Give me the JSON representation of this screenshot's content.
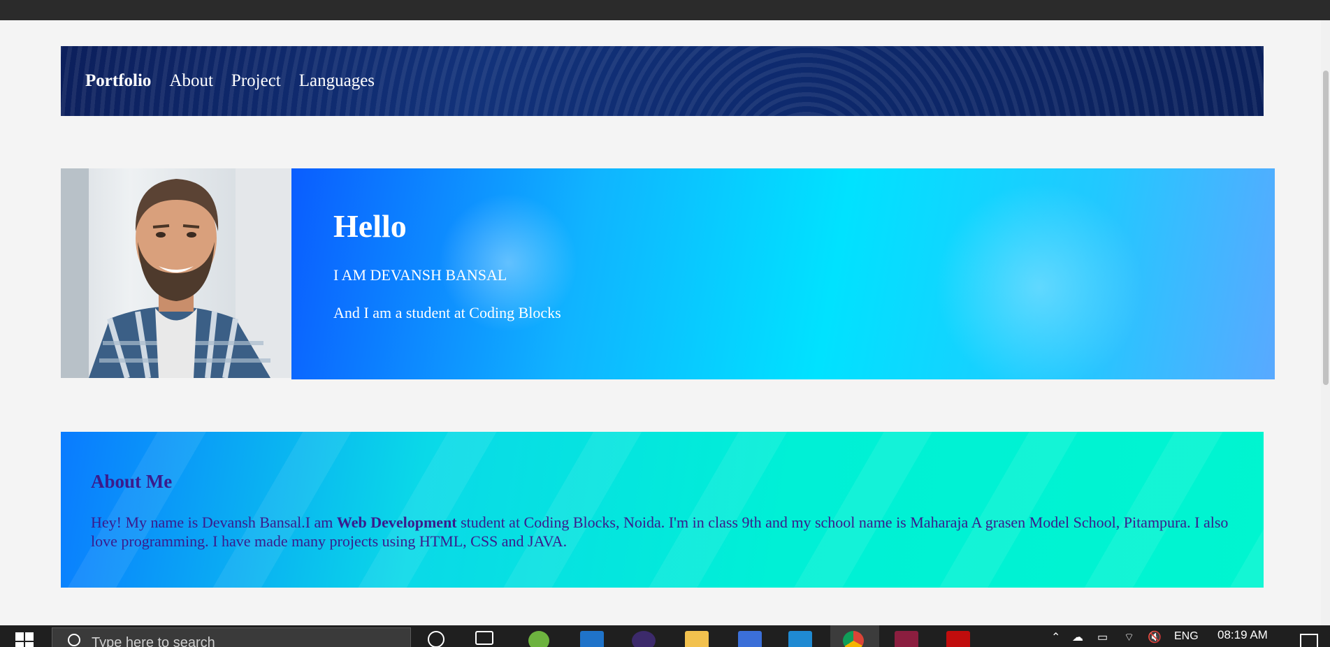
{
  "navbar": {
    "brand": "Portfolio",
    "items": [
      {
        "label": "About"
      },
      {
        "label": "Project"
      },
      {
        "label": "Languages"
      }
    ]
  },
  "hero": {
    "title": "Hello",
    "line1": "I AM DEVANSH BANSAL",
    "line2": "And I am a student at Coding Blocks",
    "avatar_alt": "profile-photo"
  },
  "about": {
    "title": "About Me",
    "text_before": "Hey! My name is Devansh Bansal.I am ",
    "text_bold": "Web Development",
    "text_after": " student at Coding Blocks, Noida. I'm in class 9th and my school name is Maharaja A grasen Model School, Pitampura. I also love programming. I have made many projects using HTML, CSS and JAVA."
  },
  "taskbar": {
    "search_placeholder": "Type here to search",
    "language": "ENG",
    "time": "08:19 AM"
  },
  "colors": {
    "navbar": "#0e2a6e",
    "hero_gradient_start": "#0a5dff",
    "hero_gradient_end": "#59a9ff",
    "about_text": "#3a1b8c",
    "about_gradient_end": "#00f5d0"
  }
}
